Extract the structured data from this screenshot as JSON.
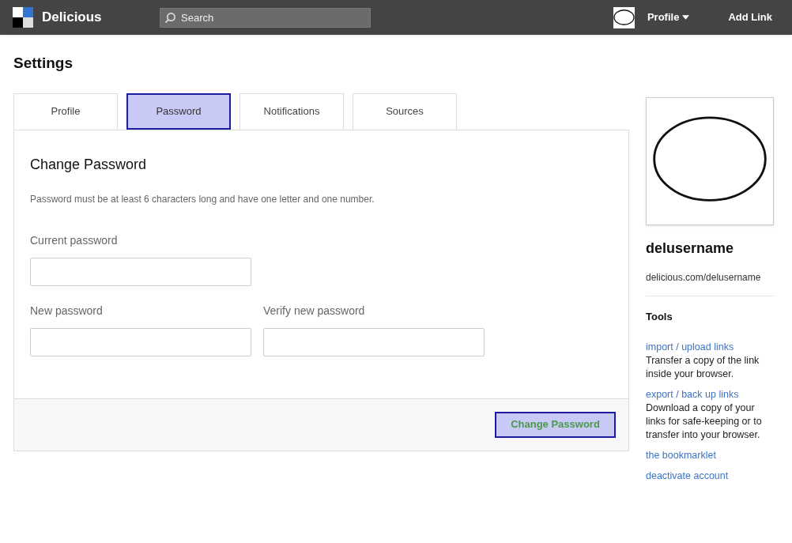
{
  "header": {
    "brand": "Delicious",
    "search": {
      "placeholder": "Search"
    },
    "profile_menu": "Profile",
    "add_link": "Add Link"
  },
  "page_title": "Settings",
  "tabs": [
    {
      "label": "Profile",
      "selected": false
    },
    {
      "label": "Password",
      "selected": true
    },
    {
      "label": "Notifications",
      "selected": false
    },
    {
      "label": "Sources",
      "selected": false
    }
  ],
  "form": {
    "title": "Change Password",
    "hint": "Password must be at least 6 characters long and have one letter and one number.",
    "fields": [
      {
        "label": "Current password"
      },
      {
        "label": "New password"
      },
      {
        "label": "Verify new password"
      }
    ],
    "submit": "Change Password"
  },
  "sidebar": {
    "username": "delusername",
    "url": "delicious.com/delusername",
    "tools_title": "Tools",
    "tools": [
      {
        "link": "import / upload links",
        "description": "Transfer a copy of the link inside your browser."
      },
      {
        "link": "export / back up links",
        "description": "Download a copy of your links for safe-keeping or to transfer into your browser."
      },
      {
        "link": "the bookmarklet"
      },
      {
        "link": "deactivate account"
      }
    ]
  }
}
